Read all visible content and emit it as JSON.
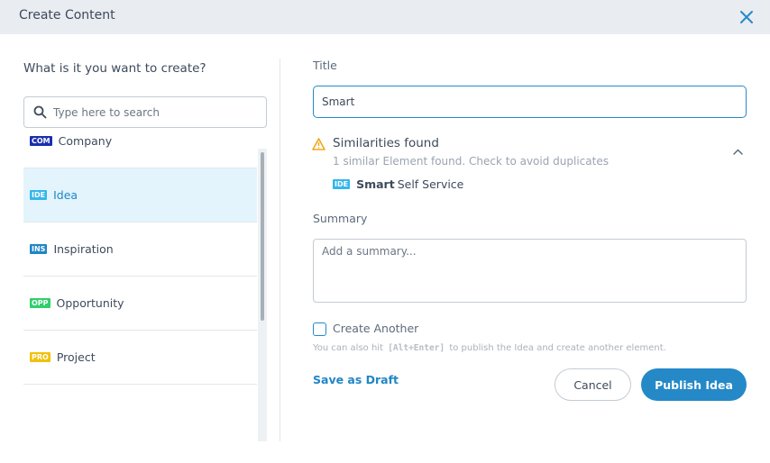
{
  "dialog": {
    "title": "Create Content",
    "close_icon": "close-icon"
  },
  "left": {
    "heading": "What is it you want to create?",
    "search": {
      "placeholder": "Type here to search",
      "value": "",
      "icon": "search-icon"
    },
    "items": [
      {
        "badge": "COM",
        "label": "Company",
        "color": "#1a2fae",
        "selected": false
      },
      {
        "badge": "IDE",
        "label": "Idea",
        "color": "#35b6ea",
        "selected": true
      },
      {
        "badge": "INS",
        "label": "Inspiration",
        "color": "#1f86c6",
        "selected": false
      },
      {
        "badge": "OPP",
        "label": "Opportunity",
        "color": "#2fcf6b",
        "selected": false
      },
      {
        "badge": "PRO",
        "label": "Project",
        "color": "#f0c10e",
        "selected": false
      }
    ]
  },
  "form": {
    "title_label": "Title",
    "title_value": "Smart",
    "similarities": {
      "icon": "warning-icon",
      "heading": "Similarities found",
      "subtitle": "1 similar Element found. Check to avoid duplicates",
      "toggle_icon": "chevron-up-icon",
      "match": {
        "badge": "IDE",
        "badge_color": "#35b6ea",
        "bold": "Smart",
        "rest": "Self Service"
      }
    },
    "summary_label": "Summary",
    "summary_placeholder": "Add a summary...",
    "summary_value": "",
    "create_another_label": "Create Another",
    "create_another_checked": false,
    "hint_before": "You can also hit",
    "hint_key": "[Alt+Enter]",
    "hint_after": "to publish the Idea and create another element.",
    "save_draft_label": "Save as Draft",
    "cancel_label": "Cancel",
    "publish_label": "Publish Idea"
  },
  "colors": {
    "accent": "#2589c8",
    "header_bg": "#e9ecf0",
    "selected_bg": "#e3f4fd",
    "warning": "#f0a81c"
  }
}
